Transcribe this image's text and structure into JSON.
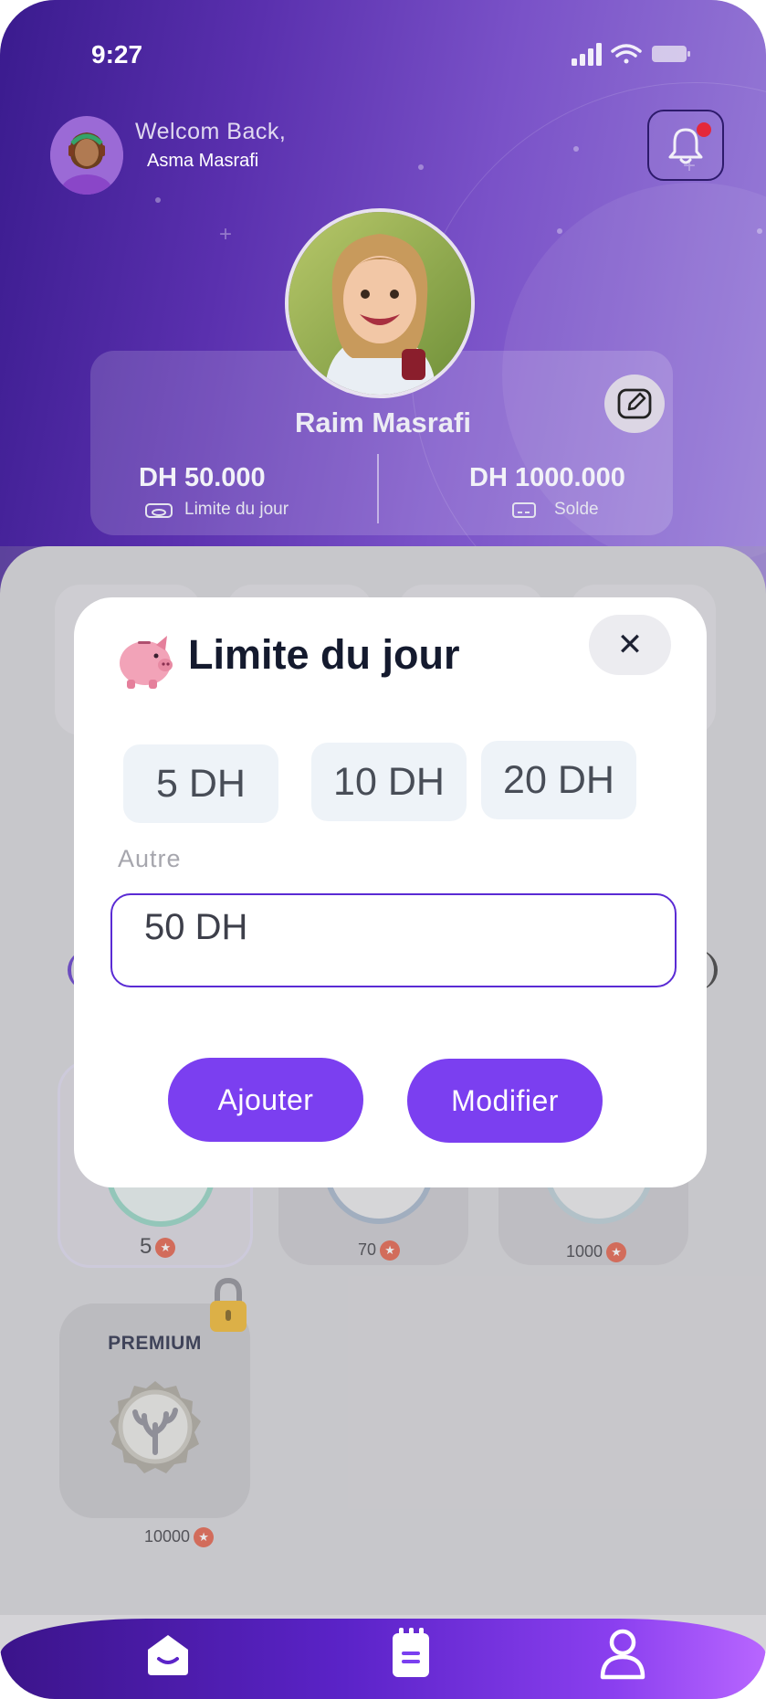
{
  "status_bar": {
    "time": "9:27"
  },
  "header": {
    "welcome_text": "Welcom Back,",
    "user_name": "Asma Masrafi",
    "notification_icon": "bell-icon",
    "has_notification": true
  },
  "child_card": {
    "child_name": "Raim Masrafi",
    "edit_icon": "edit-pencil-icon",
    "daily_limit": {
      "value": "DH 50.000",
      "label": "Limite du jour",
      "icon": "wallet-icon"
    },
    "balance": {
      "value": "DH 1000.000",
      "label": "Solde",
      "icon": "card-icon"
    }
  },
  "rewards": {
    "tiles": [
      {
        "value": "5",
        "icon": "star-badge-icon",
        "active": true
      },
      {
        "value": "70",
        "icon": "star-badge-icon",
        "active": false
      },
      {
        "value": "1000",
        "icon": "star-badge-icon",
        "active": false
      }
    ],
    "premium": {
      "label": "PREMIUM",
      "value": "10000",
      "locked": true
    }
  },
  "bottom_nav": {
    "items": [
      {
        "icon": "home-icon"
      },
      {
        "icon": "notebook-icon"
      },
      {
        "icon": "profile-icon"
      }
    ]
  },
  "modal": {
    "title": "Limite du jour",
    "icon": "piggy-bank-icon",
    "close_label": "✕",
    "preset_amounts": [
      "5 DH",
      "10 DH",
      "20 DH"
    ],
    "other_label": "Autre",
    "custom_value": "50 DH",
    "add_label": "Ajouter",
    "edit_label": "Modifier"
  },
  "colors": {
    "accent": "#7b3ff0",
    "header_dark": "#3a1b8e",
    "header_light": "#9a80d8",
    "notification": "#e5283a",
    "star_badge": "#e35b43"
  }
}
